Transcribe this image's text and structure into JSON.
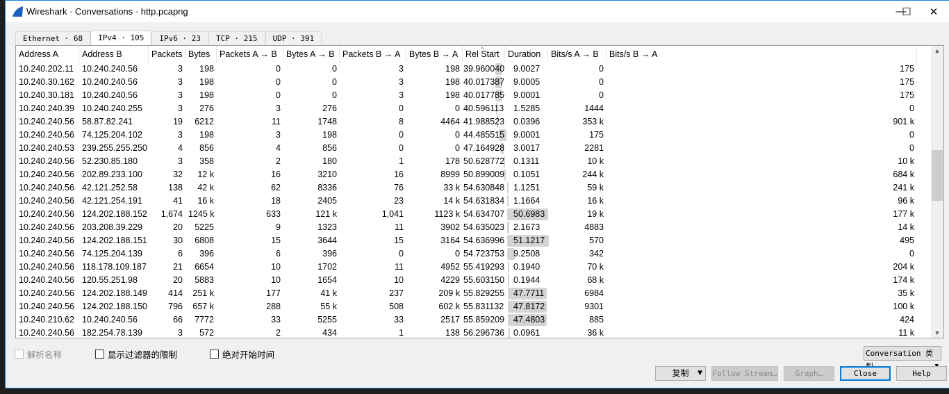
{
  "window": {
    "title": "Wireshark · Conversations · http.pcapng",
    "minimize": "—",
    "maximize": "☐",
    "close": "✕"
  },
  "tabs": [
    {
      "label": "Ethernet · 68"
    },
    {
      "label": "IPv4 · 105",
      "active": true
    },
    {
      "label": "IPv6 · 23"
    },
    {
      "label": "TCP · 215"
    },
    {
      "label": "UDP · 391"
    }
  ],
  "table": {
    "columns": [
      "Address A",
      "Address B",
      "Packets",
      "Bytes",
      "Packets A → B",
      "Bytes A → B",
      "Packets B → A",
      "Bytes B → A",
      "Rel Start",
      "Duration",
      "Bits/s A → B",
      "Bits/s B → A"
    ],
    "sort_column": "Rel Start",
    "rows": [
      [
        "10.240.202.11",
        "10.240.240.56",
        "3",
        "198",
        "0",
        "0",
        "3",
        "198",
        "39.960040",
        "9.0027",
        "0",
        "175"
      ],
      [
        "10.240.30.162",
        "10.240.240.56",
        "3",
        "198",
        "0",
        "0",
        "3",
        "198",
        "40.017387",
        "9.0005",
        "0",
        "175"
      ],
      [
        "10.240.30.181",
        "10.240.240.56",
        "3",
        "198",
        "0",
        "0",
        "3",
        "198",
        "40.017785",
        "9.0001",
        "0",
        "175"
      ],
      [
        "10.240.240.39",
        "10.240.240.255",
        "3",
        "276",
        "3",
        "276",
        "0",
        "0",
        "40.596113",
        "1.5285",
        "1444",
        "0"
      ],
      [
        "10.240.240.56",
        "58.87.82.241",
        "19",
        "6212",
        "11",
        "1748",
        "8",
        "4464",
        "41.988523",
        "0.0396",
        "353 k",
        "901 k"
      ],
      [
        "10.240.240.56",
        "74.125.204.102",
        "3",
        "198",
        "3",
        "198",
        "0",
        "0",
        "44.485515",
        "9.0001",
        "175",
        "0"
      ],
      [
        "10.240.240.53",
        "239.255.255.250",
        "4",
        "856",
        "4",
        "856",
        "0",
        "0",
        "47.164928",
        "3.0017",
        "2281",
        "0"
      ],
      [
        "10.240.240.56",
        "52.230.85.180",
        "3",
        "358",
        "2",
        "180",
        "1",
        "178",
        "50.628772",
        "0.1311",
        "10 k",
        "10 k"
      ],
      [
        "10.240.240.56",
        "202.89.233.100",
        "32",
        "12 k",
        "16",
        "3210",
        "16",
        "8999",
        "50.899009",
        "0.1051",
        "244 k",
        "684 k"
      ],
      [
        "10.240.240.56",
        "42.121.252.58",
        "138",
        "42 k",
        "62",
        "8336",
        "76",
        "33 k",
        "54.630848",
        "1.1251",
        "59 k",
        "241 k"
      ],
      [
        "10.240.240.56",
        "42.121.254.191",
        "41",
        "16 k",
        "18",
        "2405",
        "23",
        "14 k",
        "54.631834",
        "1.1664",
        "16 k",
        "96 k"
      ],
      [
        "10.240.240.56",
        "124.202.188.152",
        "1,674",
        "1245 k",
        "633",
        "121 k",
        "1,041",
        "1123 k",
        "54.634707",
        "50.6983",
        "19 k",
        "177 k"
      ],
      [
        "10.240.240.56",
        "203.208.39.229",
        "20",
        "5225",
        "9",
        "1323",
        "11",
        "3902",
        "54.635023",
        "2.1673",
        "4883",
        "14 k"
      ],
      [
        "10.240.240.56",
        "124.202.188.151",
        "30",
        "6808",
        "15",
        "3644",
        "15",
        "3164",
        "54.636996",
        "51.1217",
        "570",
        "495"
      ],
      [
        "10.240.240.56",
        "74.125.204.139",
        "6",
        "396",
        "6",
        "396",
        "0",
        "0",
        "54.723753",
        "9.2508",
        "342",
        "0"
      ],
      [
        "10.240.240.56",
        "118.178.109.187",
        "21",
        "6654",
        "10",
        "1702",
        "11",
        "4952",
        "55.419293",
        "0.1940",
        "70 k",
        "204 k"
      ],
      [
        "10.240.240.56",
        "120.55.251.98",
        "20",
        "5883",
        "10",
        "1654",
        "10",
        "4229",
        "55.603150",
        "0.1944",
        "68 k",
        "174 k"
      ],
      [
        "10.240.240.56",
        "124.202.188.149",
        "414",
        "251 k",
        "177",
        "41 k",
        "237",
        "209 k",
        "55.829255",
        "47.7711",
        "6984",
        "35 k"
      ],
      [
        "10.240.240.56",
        "124.202.188.150",
        "796",
        "657 k",
        "288",
        "55 k",
        "508",
        "602 k",
        "55.831132",
        "47.8172",
        "9301",
        "100 k"
      ],
      [
        "10.240.210.62",
        "10.240.240.56",
        "66",
        "7772",
        "33",
        "5255",
        "33",
        "2517",
        "55.859209",
        "47.4803",
        "885",
        "424"
      ],
      [
        "10.240.240.56",
        "182.254.78.139",
        "3",
        "572",
        "2",
        "434",
        "1",
        "138",
        "56.296736",
        "0.0961",
        "36 k",
        "11 k"
      ]
    ]
  },
  "options": {
    "resolve_names": "解析名称",
    "limit_to_filter": "显示过滤器的限制",
    "absolute_start": "绝对开始时间"
  },
  "conversation_type": "Conversation 类型",
  "buttons": {
    "copy": "复制",
    "follow_stream": "Follow Stream…",
    "graph": "Graph…",
    "close": "Close",
    "help": "Help"
  },
  "colors": {
    "accent": "#0078d7",
    "timeline_bar": "#d4d4d4"
  }
}
